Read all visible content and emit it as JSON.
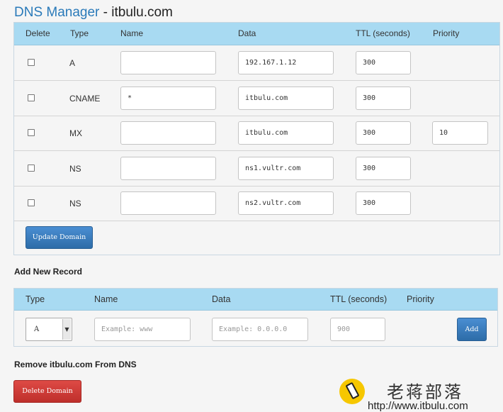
{
  "page_title": {
    "accent": "DNS Manager",
    "rest": " - itbulu.com"
  },
  "records_table": {
    "headers": {
      "delete": "Delete",
      "type": "Type",
      "name": "Name",
      "data": "Data",
      "ttl": "TTL (seconds)",
      "priority": "Priority"
    },
    "rows": [
      {
        "checked": false,
        "type": "A",
        "name": "",
        "data": "192.167.1.12",
        "ttl": "300",
        "priority": null
      },
      {
        "checked": false,
        "type": "CNAME",
        "name": "*",
        "data": "itbulu.com",
        "ttl": "300",
        "priority": null
      },
      {
        "checked": false,
        "type": "MX",
        "name": "",
        "data": "itbulu.com",
        "ttl": "300",
        "priority": "10"
      },
      {
        "checked": false,
        "type": "NS",
        "name": "",
        "data": "ns1.vultr.com",
        "ttl": "300",
        "priority": null
      },
      {
        "checked": false,
        "type": "NS",
        "name": "",
        "data": "ns2.vultr.com",
        "ttl": "300",
        "priority": null
      }
    ],
    "update_button": "Update Domain"
  },
  "add_record": {
    "title": "Add New Record",
    "headers": {
      "type": "Type",
      "name": "Name",
      "data": "Data",
      "ttl": "TTL (seconds)",
      "priority": "Priority"
    },
    "type_selected": "A",
    "name_placeholder": "Example: www",
    "data_placeholder": "Example: 0.0.0.0",
    "ttl_placeholder": "900",
    "add_button": "Add"
  },
  "remove_section": {
    "title": "Remove itbulu.com From DNS",
    "delete_button": "Delete Domain"
  },
  "watermark": {
    "text_cn": "老蒋部落",
    "url": "http://www.itbulu.com",
    "logo_color": "#f6c700"
  },
  "colors": {
    "header_bg": "#a8daf2",
    "title_accent": "#2a7ab9",
    "primary_button": "#337ab7",
    "danger_button": "#d9534f"
  }
}
